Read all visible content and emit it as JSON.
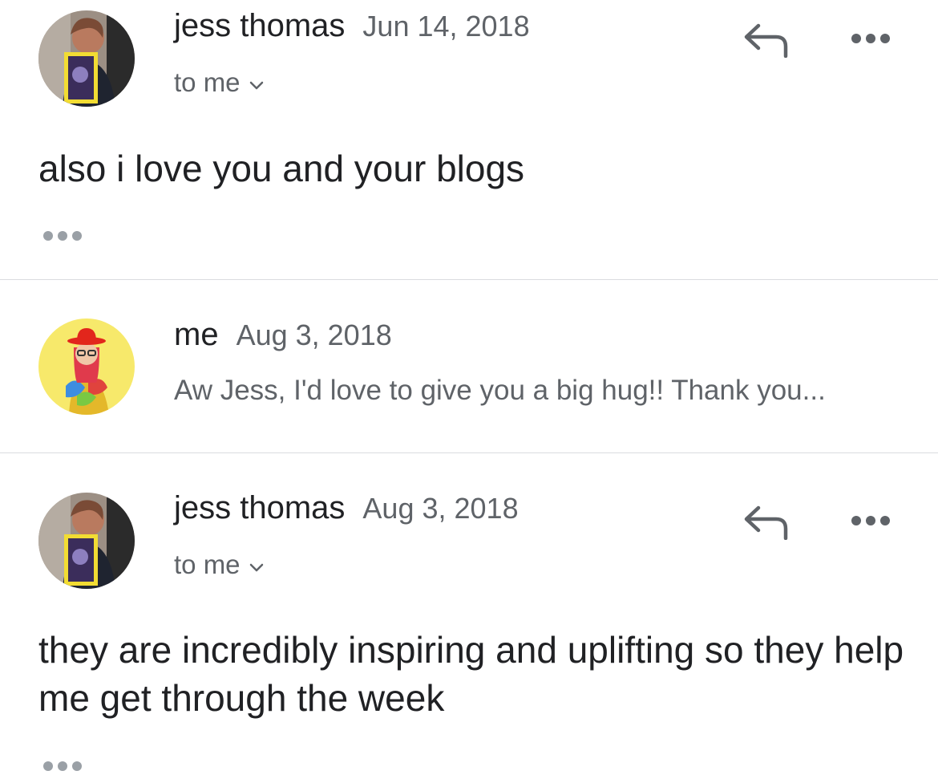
{
  "messages": [
    {
      "sender": "jess thomas",
      "date": "Jun 14, 2018",
      "recipient": "to me",
      "body": "also i love you and your blogs"
    },
    {
      "sender": "me",
      "date": "Aug 3, 2018",
      "snippet": "Aw Jess, I'd love to give you a big hug!! Thank you..."
    },
    {
      "sender": "jess thomas",
      "date": "Aug 3, 2018",
      "recipient": "to me",
      "body": "they are incredibly inspiring and uplifting so they help me get through the week"
    }
  ],
  "icons": {
    "reply": "reply-icon",
    "more": "more-options-icon",
    "expand": "show-trimmed-content-icon",
    "chevron": "chevron-down-icon"
  },
  "colors": {
    "primary_text": "#202124",
    "secondary_text": "#5f6368",
    "divider": "#dadce0",
    "icon_gray": "#5f6368",
    "expand_dots": "#9aa0a6",
    "me_avatar_bg": "#f7e96b"
  }
}
